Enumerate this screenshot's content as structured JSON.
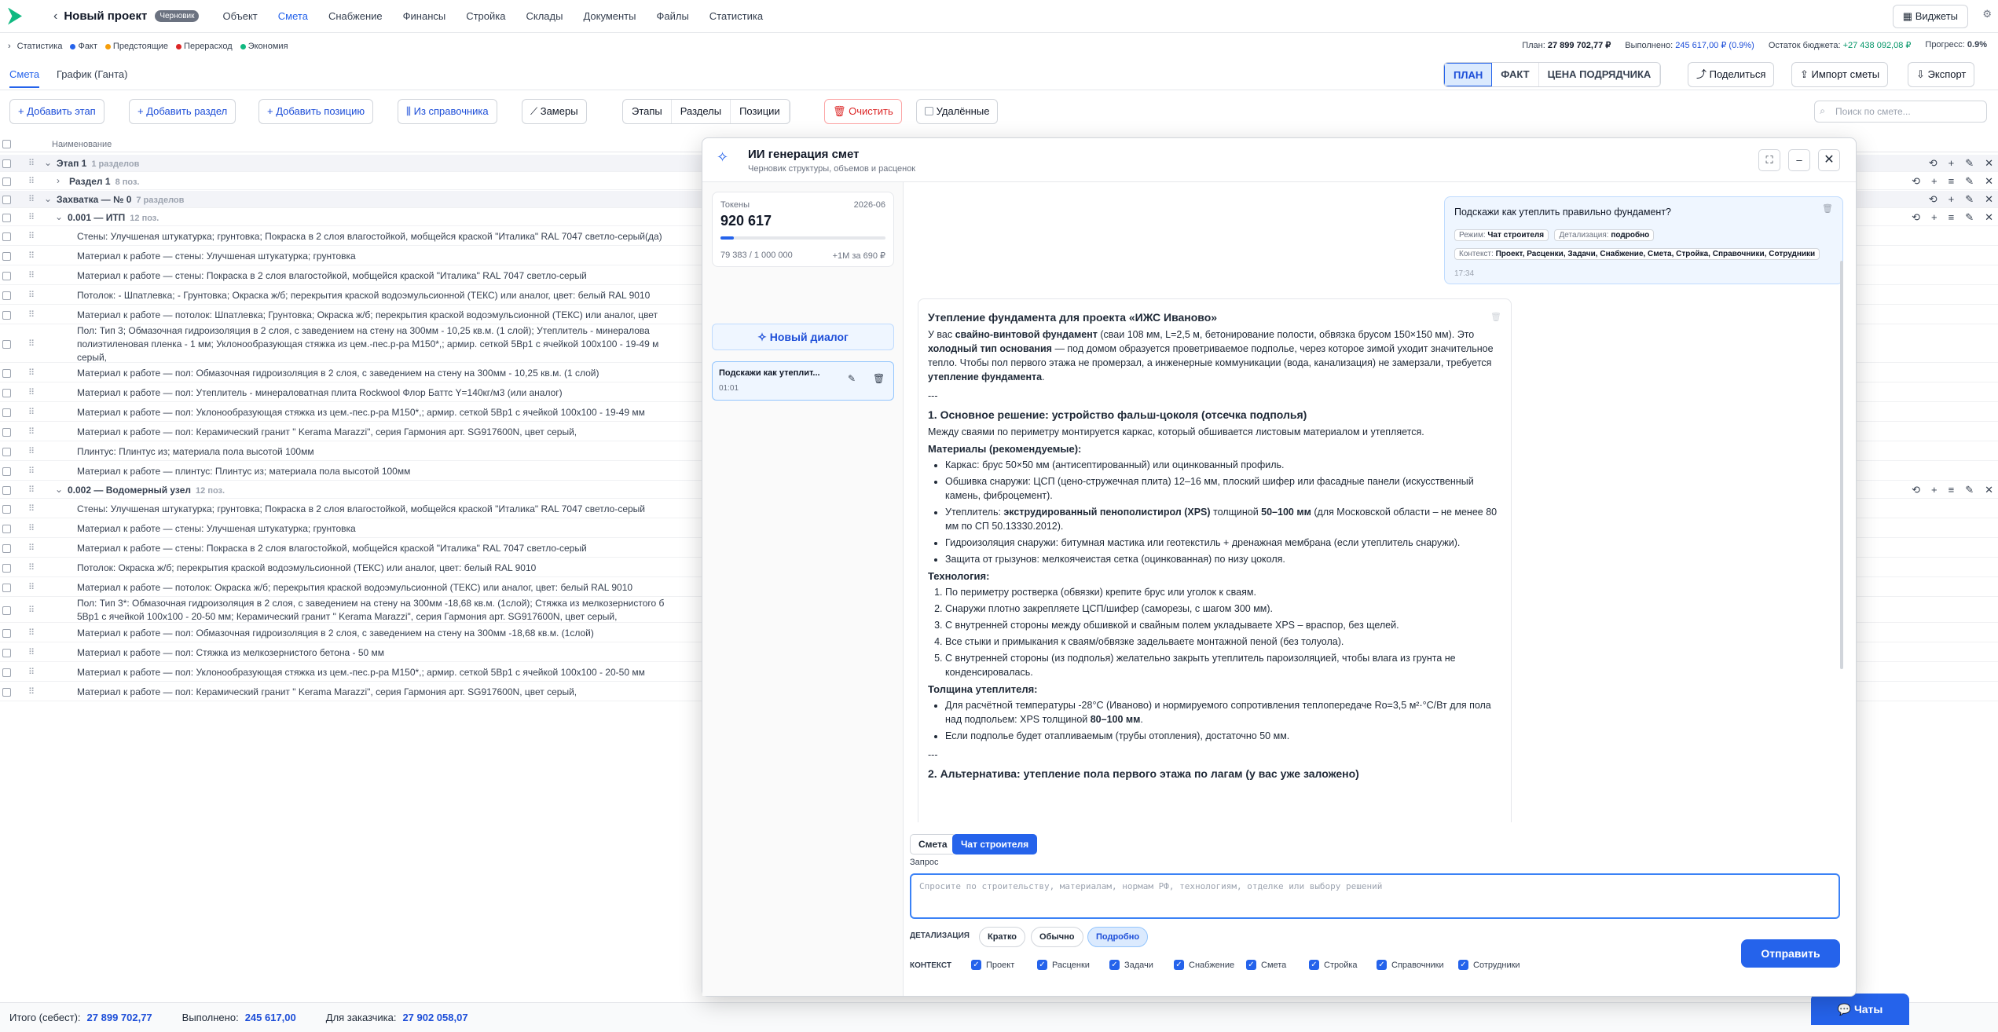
{
  "header": {
    "project_title": "Новый проект",
    "draft_badge": "Черновик",
    "nav": [
      "Объект",
      "Смета",
      "Снабжение",
      "Финансы",
      "Стройка",
      "Склады",
      "Документы",
      "Файлы",
      "Статистика"
    ],
    "widgets": "Виджеты"
  },
  "stats": {
    "label": "Статистика",
    "legend": [
      "Факт",
      "Предстоящие",
      "Перерасход",
      "Экономия"
    ],
    "legend_colors": [
      "#2563eb",
      "#f59e0b",
      "#dc2626",
      "#10b981"
    ],
    "plan_label": "План:",
    "plan": "27 899 702,77 ₽",
    "done_label": "Выполнено:",
    "done": "245 617,00 ₽ (0.9%)",
    "budget_label": "Остаток бюджета:",
    "budget": "+27 438 092,08 ₽",
    "progress_label": "Прогресс:",
    "progress": "0.9%"
  },
  "tabs": {
    "smeta": "Смета",
    "gantt": "График (Ганта)"
  },
  "modes": [
    "ПЛАН",
    "ФАКТ",
    "ЦЕНА ПОДРЯДЧИКА"
  ],
  "actions": {
    "share": "Поделиться",
    "import": "Импорт сметы",
    "export": "Экспорт"
  },
  "toolbar": {
    "add_stage": "Добавить этап",
    "add_section": "Добавить раздел",
    "add_item": "Добавить позицию",
    "from_catalog": "Из справочника",
    "measures": "Замеры",
    "views": [
      "Этапы",
      "Разделы",
      "Позиции"
    ],
    "clear": "Очистить",
    "deleted": "Удалённые",
    "search_placeholder": "Поиск по смете..."
  },
  "table": {
    "col_name": "Наименование",
    "rows": [
      {
        "type": "stage",
        "name": "Этап 1",
        "count": "1 разделов"
      },
      {
        "type": "section",
        "name": "Раздел 1",
        "count": "8 поз."
      },
      {
        "type": "stage",
        "name": "Захватка — № 0",
        "count": "7 разделов"
      },
      {
        "type": "sub",
        "name": "0.001 — ИТП",
        "count": "12 поз."
      },
      {
        "type": "item",
        "name": "Стены: Улучшеная штукатурка; грунтовка; Покраска в 2 слоя влагостойкой, мобщейся краской \"Италика\" RAL 7047 светло-серый(да)"
      },
      {
        "type": "item",
        "name": "Материал к работе — стены: Улучшеная штукатурка; грунтовка"
      },
      {
        "type": "item",
        "name": "Материал к работе — стены: Покраска в 2 слоя влагостойкой, мобщейся краской \"Италика\" RAL 7047 светло-серый"
      },
      {
        "type": "item",
        "name": "Потолок: - Шпатлевка; - Грунтовка; Окраска ж/б; перекрытия краской водоэмульсионной (ТЕКС) или аналог, цвет: белый RAL 9010"
      },
      {
        "type": "item",
        "name": "Материал к работе — потолок: Шпатлевка; Грунтовка; Окраска ж/б; перекрытия краской водоэмульсионной (ТЕКС) или аналог, цвет"
      },
      {
        "type": "item3",
        "name": "Пол: Тип 3; Обмазочная гидроизоляция в 2 слоя, с заведением на стену на 300мм - 10,25 кв.м. (1 слой); Утеплитель - минералова\nполиэтиленовая пленка - 1 мм; Уклонообразующая стяжка из цем.-пес.р-ра М150*,; армир. сеткой 5Вр1 с ячейкой 100х100 - 19-49 м\nсерый,"
      },
      {
        "type": "item",
        "name": "Материал к работе — пол: Обмазочная гидроизоляция в 2 слоя, с заведением на стену на 300мм - 10,25 кв.м. (1 слой)"
      },
      {
        "type": "item",
        "name": "Материал к работе — пол: Утеплитель - минераловатная плита Rockwool Флор Баттс Y=140кг/м3 (или аналог)"
      },
      {
        "type": "item",
        "name": "Материал к работе — пол: Уклонообразующая стяжка из цем.-пес.р-ра М150*,; армир. сеткой 5Вр1 с ячейкой 100х100 - 19-49 мм"
      },
      {
        "type": "item",
        "name": "Материал к работе — пол: Керамический гранит \" Kerama Marazzi\", серия Гармония арт. SG917600N, цвет серый,"
      },
      {
        "type": "item",
        "name": "Плинтус: Плинтус из; материала пола высотой 100мм"
      },
      {
        "type": "item",
        "name": "Материал к работе — плинтус: Плинтус из; материала пола высотой 100мм"
      },
      {
        "type": "sub",
        "name": "0.002 — Водомерный узел",
        "count": "12 поз."
      },
      {
        "type": "item",
        "name": "Стены: Улучшеная штукатурка; грунтовка; Покраска в 2 слоя влагостойкой, мобщейся краской \"Италика\" RAL 7047 светло-серый"
      },
      {
        "type": "item",
        "name": "Материал к работе — стены: Улучшеная штукатурка; грунтовка"
      },
      {
        "type": "item",
        "name": "Материал к работе — стены: Покраска в 2 слоя влагостойкой, мобщейся краской \"Италика\" RAL 7047 светло-серый"
      },
      {
        "type": "item",
        "name": "Потолок: Окраска ж/б; перекрытия краской водоэмульсионной (ТЕКС) или аналог, цвет: белый RAL 9010"
      },
      {
        "type": "item",
        "name": "Материал к работе — потолок: Окраска ж/б; перекрытия краской водоэмульсионной (ТЕКС) или аналог, цвет: белый RAL 9010"
      },
      {
        "type": "item2",
        "name": "Пол: Тип 3*: Обмазочная гидроизоляция в 2 слоя, с заведением на стену на 300мм -18,68 кв.м. (1слой); Стяжка из мелкозернистого б\n5Вр1 с ячейкой 100х100 - 20-50 мм; Керамический гранит \" Kerama Marazzi\", серия Гармония арт. SG917600N, цвет серый,"
      },
      {
        "type": "item",
        "name": "Материал к работе — пол: Обмазочная гидроизоляция в 2 слоя, с заведением на стену на 300мм -18,68 кв.м. (1слой)"
      },
      {
        "type": "item",
        "name": "Материал к работе — пол: Стяжка из мелкозернистого бетона - 50 мм"
      },
      {
        "type": "item",
        "name": "Материал к работе — пол: Уклонообразующая стяжка из цем.-пес.р-ра М150*,; армир. сеткой 5Вр1 с ячейкой 100х100 - 20-50 мм"
      },
      {
        "type": "item",
        "name": "Материал к работе — пол: Керамический гранит \" Kerama Marazzi\", серия Гармония арт. SG917600N, цвет серый,"
      }
    ]
  },
  "footer": {
    "total_label": "Итого (себест):",
    "total": "27 899 702,77",
    "done_label": "Выполнено:",
    "done": "245 617,00",
    "client_label": "Для заказчика:",
    "client": "27 902 058,07",
    "chats": "Чаты"
  },
  "modal": {
    "title": "ИИ генерация смет",
    "subtitle": "Черновик структуры, объемов и расценок",
    "tokens_label": "Токены",
    "tokens_period": "2026-06",
    "tokens_value": "920 617",
    "tokens_used": "79 383 / 1 000 000",
    "tokens_extra": "+1М за 690 ₽",
    "tokens_fraction": 0.08,
    "new_dialog": "Новый диалог",
    "dialog_title": "Подскажи как утеплит...",
    "dialog_time": "01:01",
    "user_msg": {
      "text": "Подскажи как утеплить правильно фундамент?",
      "mode_label": "Режим:",
      "mode": "Чат строителя",
      "detail_label": "Детализация:",
      "detail": "подробно",
      "context_label": "Контекст:",
      "context": "Проект, Расценки, Задачи, Снабжение, Смета, Стройка, Справочники, Сотрудники",
      "time": "17:34"
    },
    "answer": {
      "title": "Утепление фундамента для проекта «ИЖС Иваново»",
      "intro_a": "У вас ",
      "intro_b": "свайно-винтовой фундамент",
      "intro_c": " (сваи 108 мм, L=2,5 м, бетонирование полости, обвязка брусом 150×150 мм). Это ",
      "intro_d": "холодный тип основания",
      "intro_e": " — под домом образуется проветриваемое подполье, через которое зимой уходит значительное тепло. Чтобы пол первого этажа не промерзал, а инженерные коммуникации (вода, канализация) не замерзали, требуется ",
      "intro_f": "утепление фундамента",
      "intro_g": ".",
      "sep": "---",
      "h1": "1. Основное решение: устройство фальш-цоколя (отсечка подполья)",
      "p1": "Между сваями по периметру монтируется каркас, который обшивается листовым материалом и утепляется.",
      "mat_title": "Материалы (рекомендуемые):",
      "mat": [
        "Каркас: брус 50×50 мм (антисептированный) или оцинкованный профиль.",
        "Обшивка снаружи: ЦСП (цено-стружечная плита) 12–16 мм, плоский шифер или фасадные панели (искусственный камень, фиброцемент)."
      ],
      "mat3_a": "Утеплитель: ",
      "mat3_b": "экструдированный пенополистирол (XPS)",
      "mat3_c": " толщиной ",
      "mat3_d": "50–100 мм",
      "mat3_e": " (для Московской области – не менее 80 мм по СП 50.13330.2012).",
      "mat_rest": [
        "Гидроизоляция снаружи: битумная мастика или геотекстиль + дренажная мембрана (если утеплитель снаружи).",
        "Защита от грызунов: мелкоячеистая сетка (оцинкованная) по низу цоколя."
      ],
      "tech_title": "Технология:",
      "tech": [
        "По периметру ростверка (обвязки) крепите брус или уголок к сваям.",
        "Снаружи плотно закрепляете ЦСП/шифер (саморезы, с шагом 300 мм).",
        "С внутренней стороны между обшивкой и свайным полем укладываете XPS – враспор, без щелей.",
        "Все стыки и примыкания к сваям/обвязке задельваете монтажной пеной (без толуола).",
        "С внутренней стороны (из подполья) желательно закрыть утеплитель пароизоляцией, чтобы влага из грунта не конденсировалась."
      ],
      "thick_title": "Толщина утеплителя:",
      "thick1_a": "Для расчётной температуры -28°C (Иваново) и нормируемого сопротивления теплопередаче Ro=3,5 м²·°C/Вт для пола над подпольем: XPS толщиной ",
      "thick1_b": "80–100 мм",
      "thick1_c": ".",
      "thick2": "Если подполье будет отапливаемым (трубы отопления), достаточно 50 мм.",
      "h2": "2. Альтернатива: утепление пола первого этажа по лагам (у вас уже заложено)"
    },
    "mode_tabs": [
      "Смета",
      "Чат строителя"
    ],
    "query_label": "Запрос",
    "query_placeholder": "Спросите по строительству, материалам, нормам РФ, технологиям, отделке или выбору решений",
    "detail_label": "ДЕТАЛИЗАЦИЯ",
    "detail_opts": [
      "Кратко",
      "Обычно",
      "Подробно"
    ],
    "context_label": "КОНТЕКСТ",
    "context_opts": [
      "Проект",
      "Расценки",
      "Задачи",
      "Снабжение",
      "Смета",
      "Стройка",
      "Справочники",
      "Сотрудники"
    ],
    "send": "Отправить"
  }
}
